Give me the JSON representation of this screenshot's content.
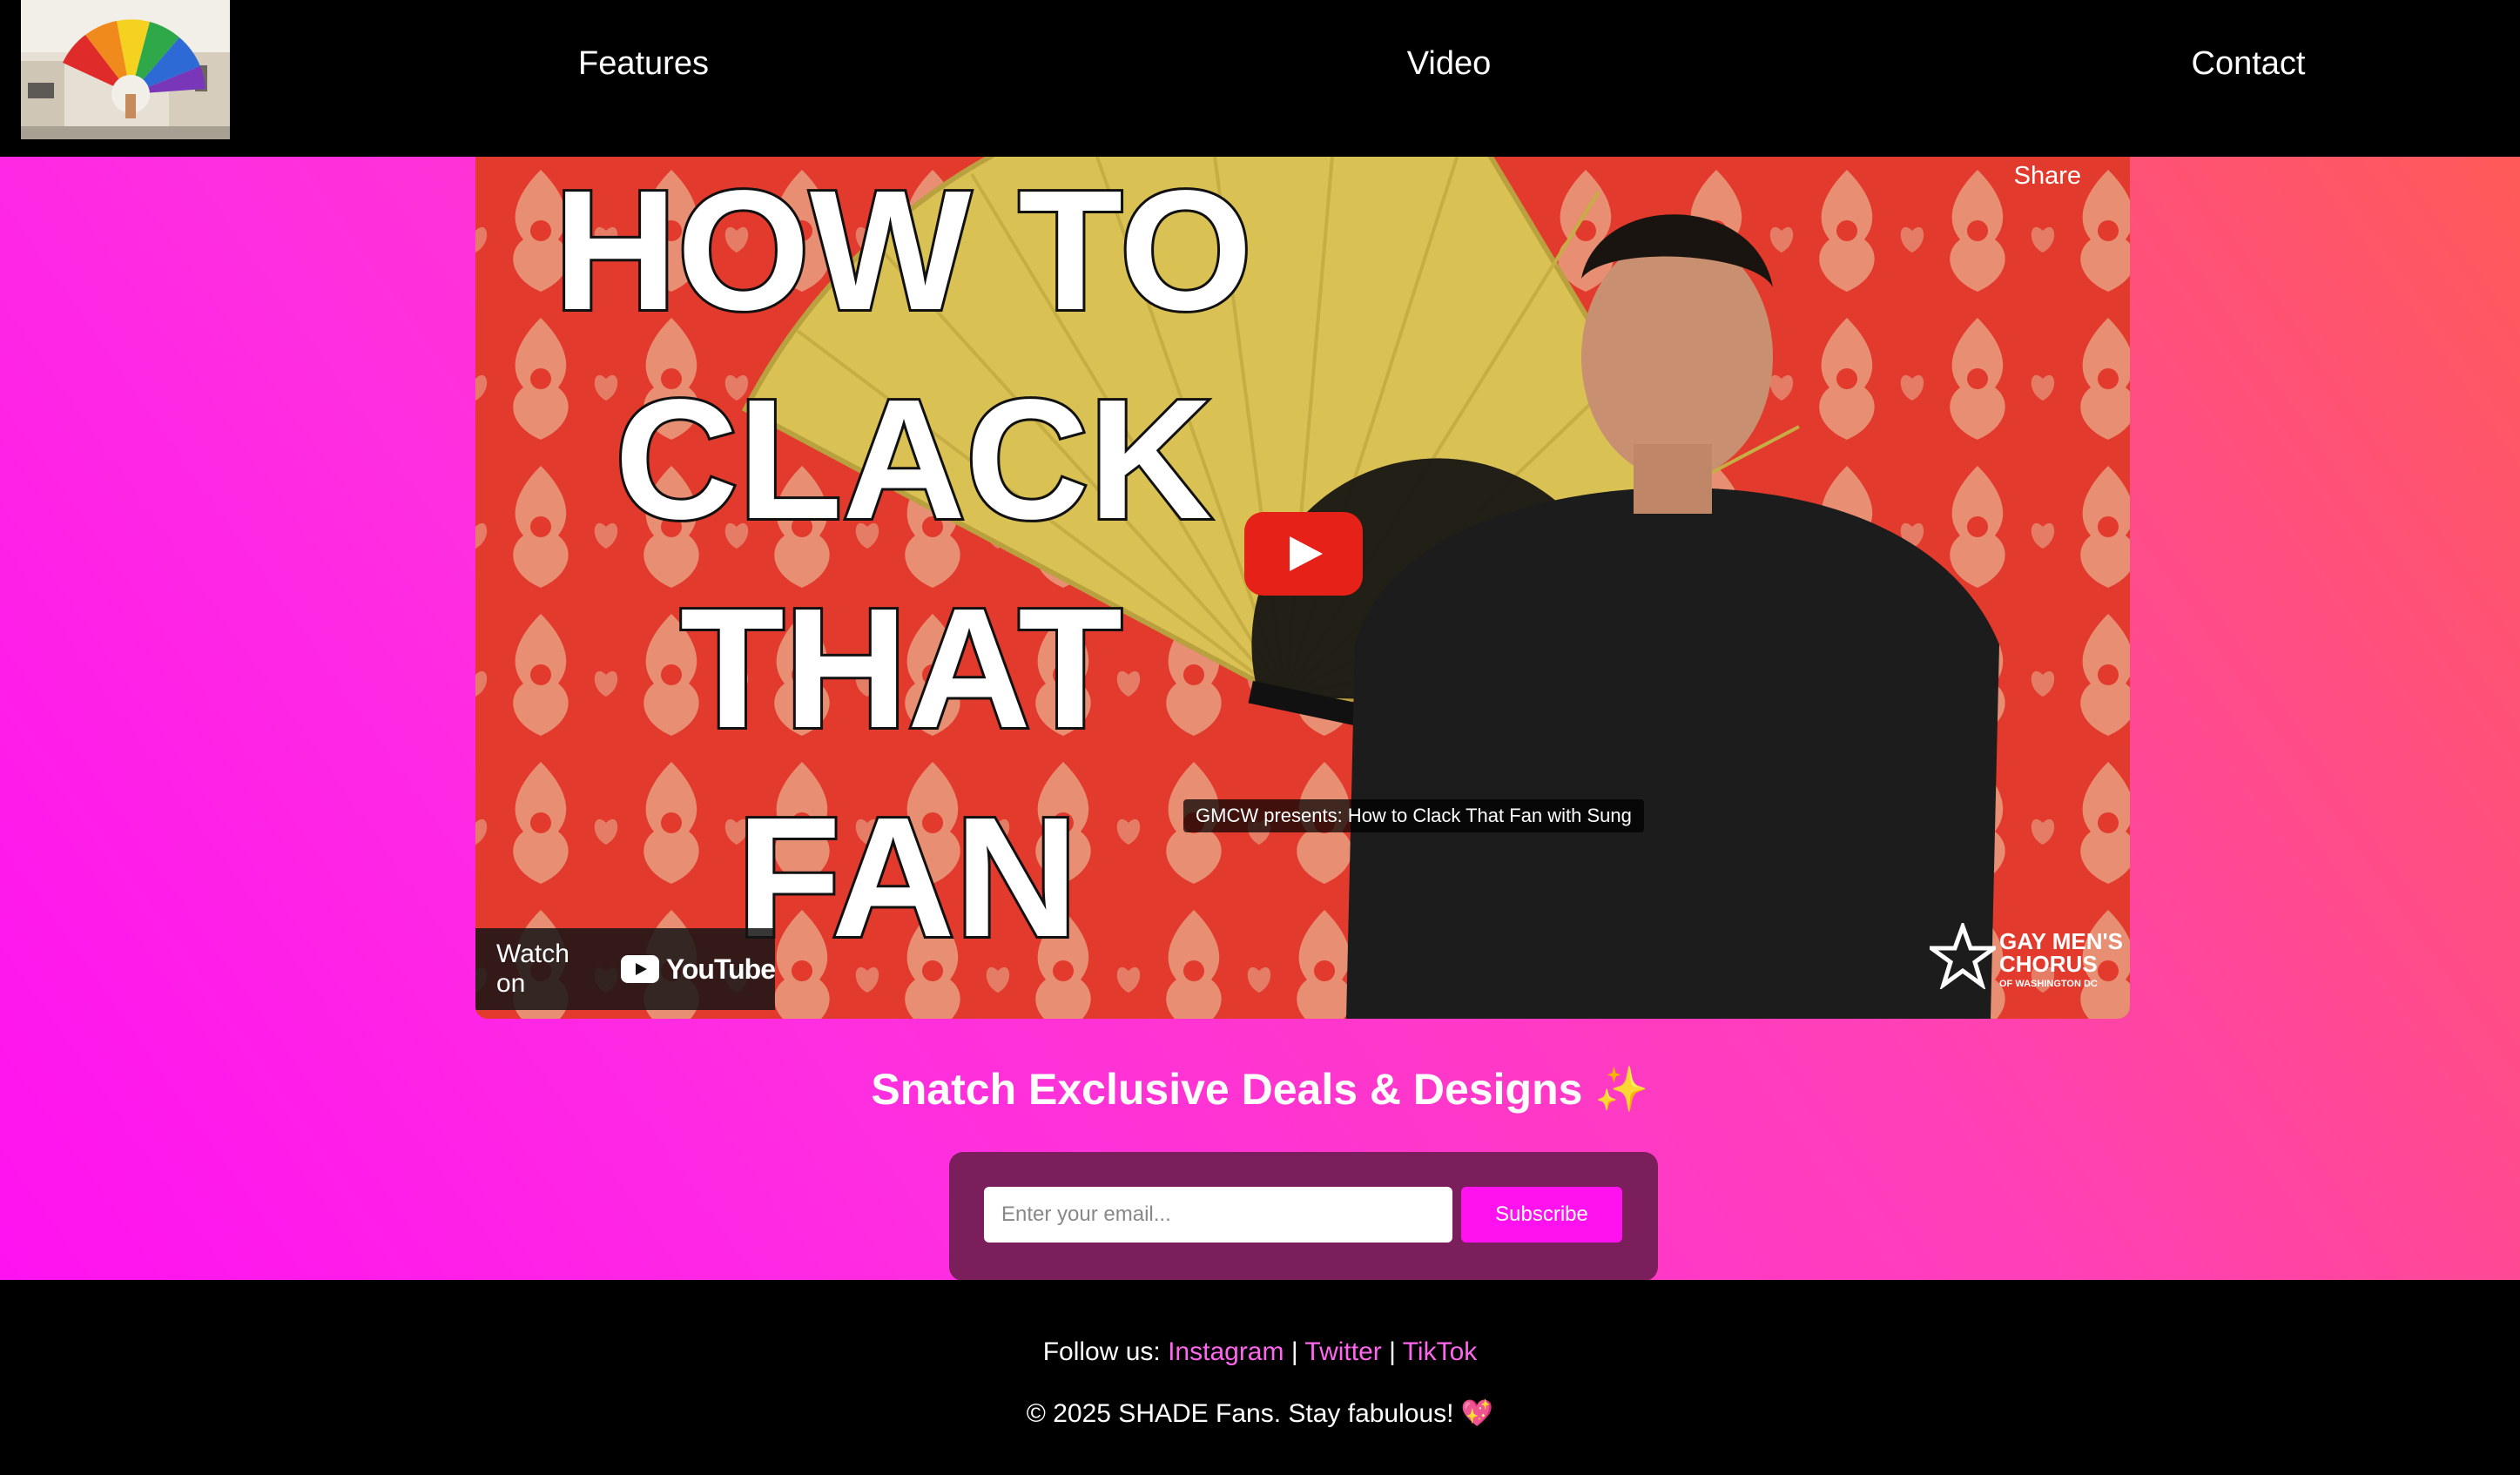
{
  "header": {
    "logo_alt": "SHADE Fans logo",
    "nav": [
      "Features",
      "Video",
      "Contact"
    ]
  },
  "video": {
    "share_label": "Share",
    "thumbnail_title_lines": [
      "HOW TO",
      "CLACK",
      "THAT",
      "FAN"
    ],
    "caption": "GMCW presents: How to Clack That Fan with Sung",
    "watch_on": "Watch on",
    "youtube_wordmark": "YouTube",
    "channel_badge": {
      "line1": "GAY MEN'S",
      "line2": "CHORUS",
      "line3": "OF WASHINGTON DC"
    },
    "play_icon": "play-icon"
  },
  "signup": {
    "heading": "Snatch Exclusive Deals & Designs ✨",
    "email_placeholder": "Enter your email...",
    "subscribe_label": "Subscribe"
  },
  "footer": {
    "follow_label": "Follow us:",
    "links": [
      "Instagram",
      "Twitter",
      "TikTok"
    ],
    "separator": "|",
    "copyright": "© 2025 SHADE Fans. Stay fabulous! 💖"
  },
  "colors": {
    "accent": "#ff12ee",
    "link": "#ff66ee",
    "form_bg": "#7b1f5c",
    "youtube_red": "#e62117"
  }
}
